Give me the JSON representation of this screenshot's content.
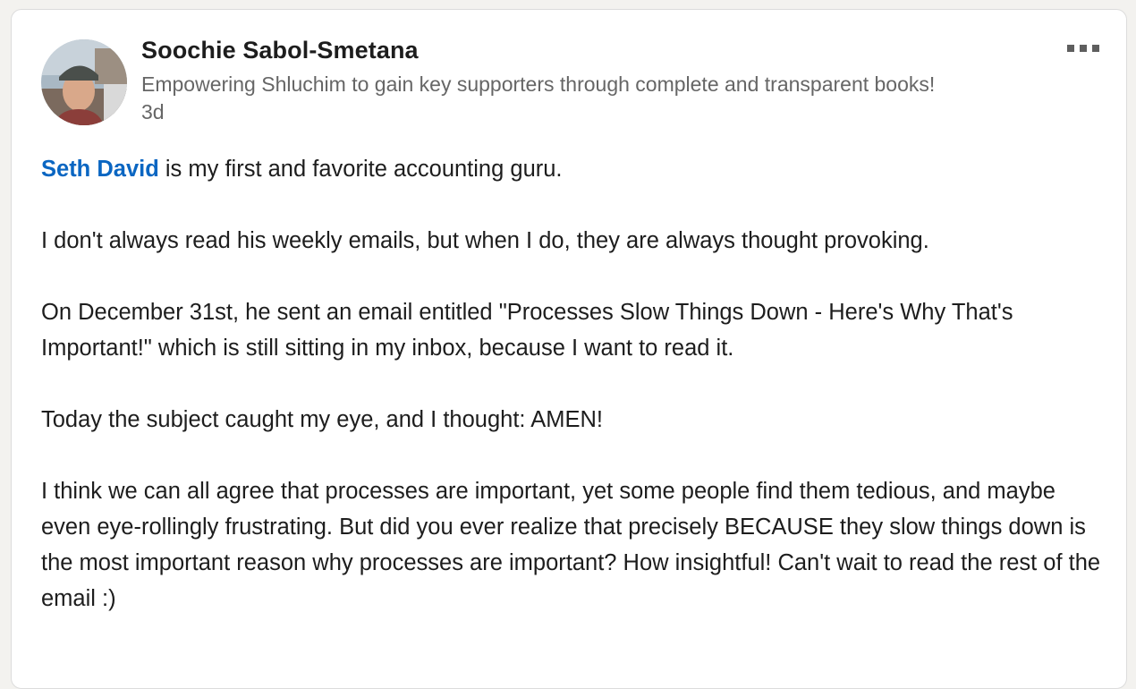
{
  "post": {
    "author": {
      "name": "Soochie Sabol-Smetana",
      "headline": "Empowering Shluchim to gain key supporters through complete and transparent books!",
      "time": "3d",
      "avatar_icon": "profile-photo"
    },
    "menu_icon": "more-options-icon",
    "mention": "Seth David",
    "paragraphs": [
      " is my first and favorite accounting guru.",
      "I don't always read his weekly emails, but when I do, they are always thought provoking.",
      "On December 31st, he sent an email entitled \"Processes Slow Things Down - Here's Why That's Important!\" which is still sitting in my inbox, because I want to read it.",
      "Today the subject caught my eye, and I thought: AMEN!",
      "I think we can all agree that processes are important, yet some people find them tedious, and maybe even eye-rollingly frustrating. But did you ever realize that precisely BECAUSE they slow things down is the most important reason why processes are important? How insightful! Can't wait to read the rest of the email :)"
    ]
  },
  "colors": {
    "mention": "#0a66c2",
    "text": "#1d1d1d",
    "secondary_text": "#666666",
    "card_border": "#dcdcdc"
  }
}
